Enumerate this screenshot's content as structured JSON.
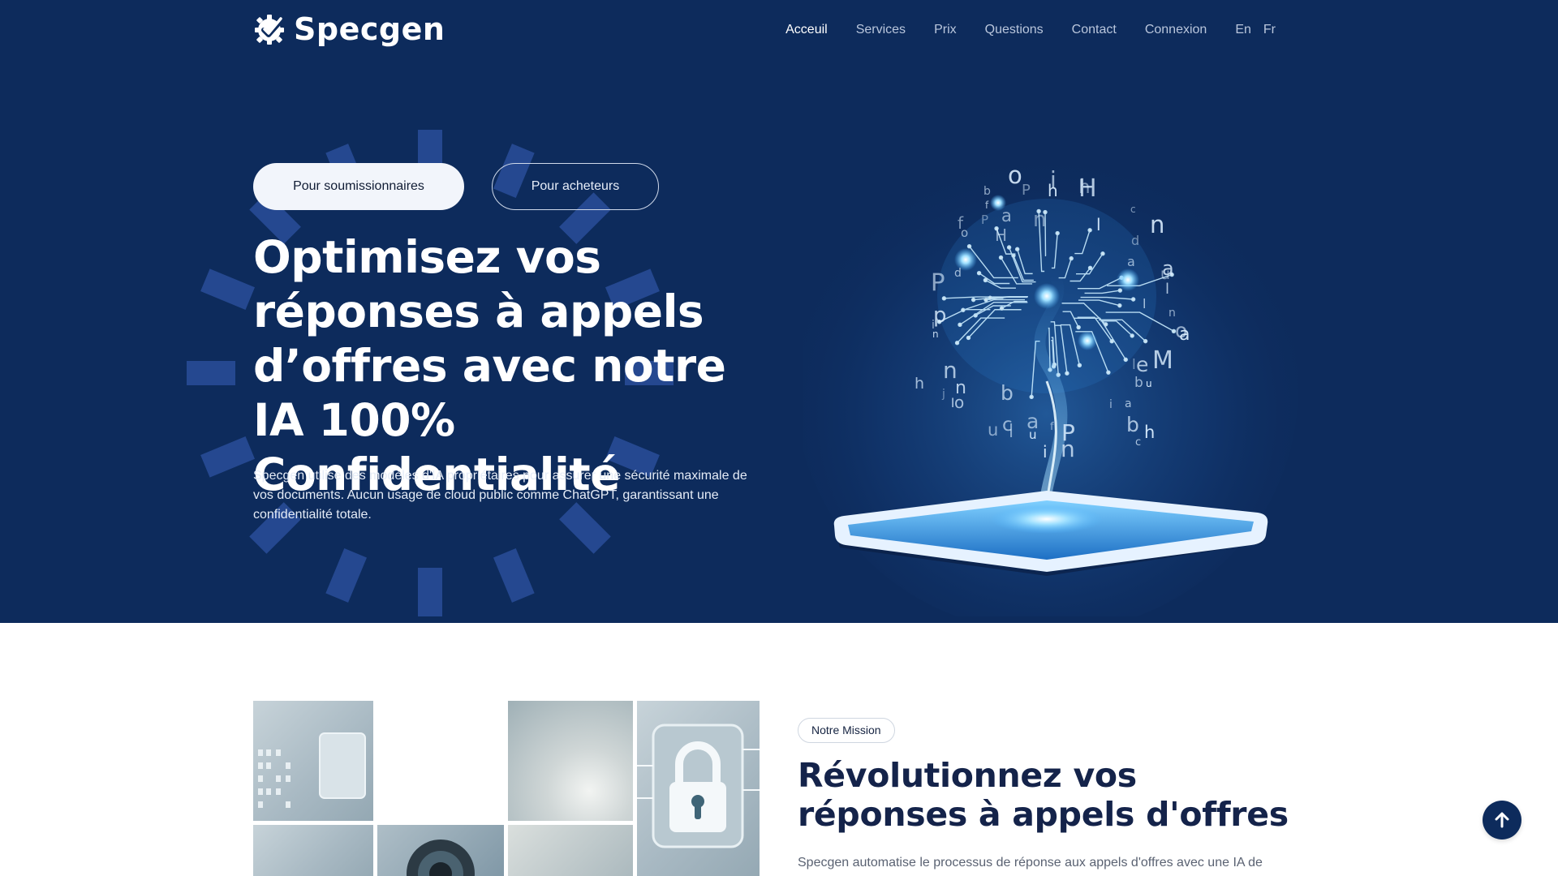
{
  "brand": {
    "name": "Specgen"
  },
  "nav": {
    "items": [
      "Acceuil",
      "Services",
      "Prix",
      "Questions",
      "Contact",
      "Connexion"
    ],
    "active": "Acceuil",
    "languages": [
      "En",
      "Fr"
    ]
  },
  "hero": {
    "tabs": {
      "primary": "Pour soumissionnaires",
      "secondary": "Pour acheteurs"
    },
    "title": "Optimisez vos réponses à appels d’offres avec notre IA 100% Confidentialité",
    "description": "Specgen utilise des modèles d'IA propriétaires pour assurer une sécurité maximale de vos documents. Aucun usage de cloud public comme ChatGPT, garantissant une confidentialité totale."
  },
  "mission": {
    "badge": "Notre Mission",
    "title": "Révolutionnez vos réponses à appels d'offres",
    "description": "Specgen automatise le processus de réponse aux appels d'offres avec une IA de"
  },
  "icons": {
    "logo": "gear-check-icon",
    "scroll_top": "arrow-up-icon",
    "collage_lock": "padlock-icon"
  },
  "colors": {
    "hero_bg": "#0d2b5c",
    "ray": "#2a4f9a",
    "title_dark": "#14234a",
    "glow": "#4fb6ff"
  }
}
